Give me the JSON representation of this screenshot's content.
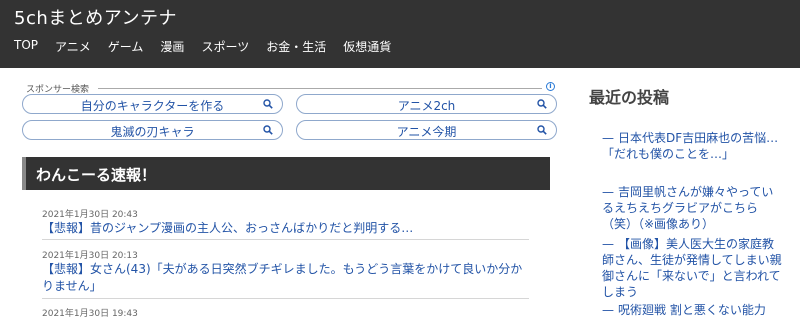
{
  "site": {
    "title": "5chまとめアンテナ"
  },
  "nav": {
    "items": [
      "TOP",
      "アニメ",
      "ゲーム",
      "漫画",
      "スポーツ",
      "お金・生活",
      "仮想通貨"
    ]
  },
  "sponsor": {
    "label": "スポンサー検索",
    "info_icon": "info-icon",
    "searches": [
      "自分のキャラクターを作る",
      "アニメ2ch",
      "鬼滅の刃キャラ",
      "アニメ今期"
    ]
  },
  "blog": {
    "title": "わんこーる速報！",
    "articles": [
      {
        "date": "2021年1月30日 20:43",
        "title": "【悲報】昔のジャンプ漫画の主人公、おっさんばかりだと判明する…"
      },
      {
        "date": "2021年1月30日 20:13",
        "title": "【悲報】女さん(43)「夫がある日突然ブチギレました。もうどう言葉をかけて良いか分かりません」"
      },
      {
        "date": "2021年1月30日 19:43",
        "title": ""
      }
    ]
  },
  "sidebar": {
    "title": "最近の投稿",
    "posts": [
      "日本代表DF吉田麻也の苦悩…「だれも僕のことを…」",
      "吉岡里帆さんが嫌々やっているえちえちグラビアがこちら（笑）（※画像あり）",
      "【画像】美人医大生の家庭教師さん、生徒が発情してしまい親御さんに「来ないで」と言われてしまう",
      "呪術廻戦 割と悪くない能力"
    ]
  },
  "colors": {
    "header_bg": "#333333",
    "link": "#2253a6"
  }
}
